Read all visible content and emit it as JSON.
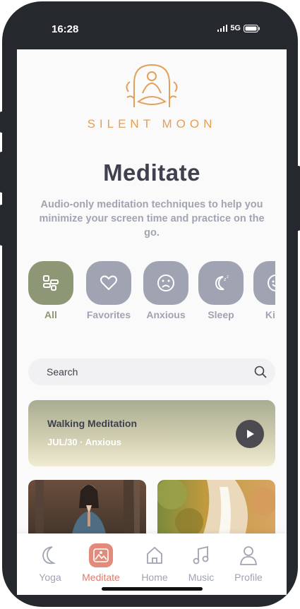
{
  "status": {
    "time": "16:28",
    "network": "5G"
  },
  "brand": {
    "name": "SILENT MOON"
  },
  "header": {
    "title": "Meditate",
    "subtitle": "Audio-only meditation techniques to help you minimize your screen time and practice on the go."
  },
  "categories": [
    {
      "label": "All",
      "icon": "grid-icon",
      "active": true
    },
    {
      "label": "Favorites",
      "icon": "heart-icon"
    },
    {
      "label": "Anxious",
      "icon": "sad-face-icon"
    },
    {
      "label": "Sleep",
      "icon": "moon-icon"
    },
    {
      "label": "Kids",
      "icon": "smile-icon"
    }
  ],
  "search": {
    "placeholder": "Search"
  },
  "featured": {
    "title": "Walking Meditation",
    "meta": "JUL/30 · Anxious"
  },
  "nav": [
    {
      "label": "Yoga",
      "icon": "moon-icon"
    },
    {
      "label": "Meditate",
      "icon": "meditate-icon",
      "active": true
    },
    {
      "label": "Home",
      "icon": "home-icon"
    },
    {
      "label": "Music",
      "icon": "music-icon"
    },
    {
      "label": "Profile",
      "icon": "profile-icon"
    }
  ],
  "colors": {
    "accent": "#8e9775",
    "nav_active": "#e28b7a",
    "text": "#3f414e",
    "muted": "#a0a3b1",
    "brand": "#e2a05a"
  }
}
